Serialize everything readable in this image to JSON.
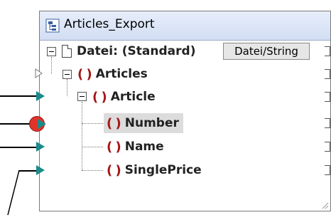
{
  "component": {
    "title": "Articles_Export",
    "file_label": "Datei: (Standard)",
    "file_button": "Datei/String"
  },
  "tree": {
    "articles": "Articles",
    "article": "Article",
    "number": "Number",
    "name": "Name",
    "singleprice": "SinglePrice"
  },
  "icons": {
    "element_glyph": "()",
    "element_color": "#a31515",
    "port_color": "#1a8a8a",
    "error_port_color": "#e0342a"
  }
}
